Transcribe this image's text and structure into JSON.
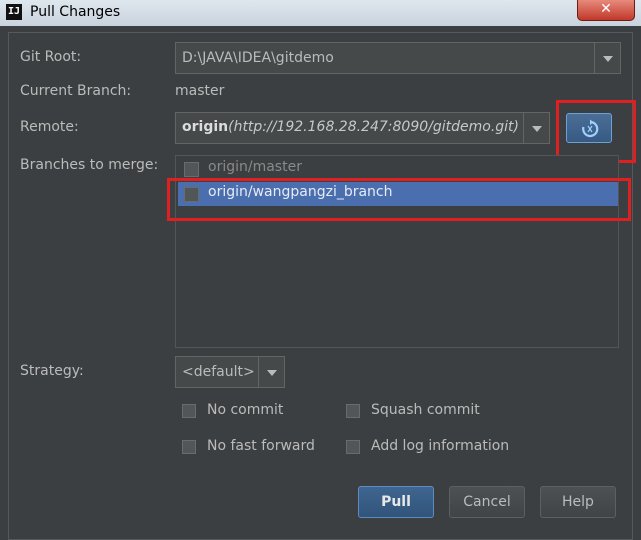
{
  "window": {
    "title": "Pull Changes",
    "app_icon_text": "IJ",
    "close_glyph": "✕"
  },
  "form": {
    "git_root": {
      "label": "Git Root:",
      "value": "D:\\JAVA\\IDEA\\gitdemo"
    },
    "current_branch": {
      "label": "Current Branch:",
      "value": "master"
    },
    "remote": {
      "label": "Remote:",
      "name": "origin",
      "url": "(http://192.168.28.247:8090/gitdemo.git)"
    },
    "branches": {
      "label": "Branches to merge:",
      "items": [
        {
          "name": "origin/master",
          "checked": false,
          "selected": false,
          "enabled": false
        },
        {
          "name": "origin/wangpangzi_branch",
          "checked": false,
          "selected": true,
          "enabled": true
        }
      ]
    },
    "strategy": {
      "label": "Strategy:",
      "value": "<default>"
    },
    "options": {
      "no_commit": "No commit",
      "squash_commit": "Squash commit",
      "no_fast_forward": "No fast forward",
      "add_log_information": "Add log information"
    }
  },
  "buttons": {
    "pull": "Pull",
    "cancel": "Cancel",
    "help": "Help"
  },
  "icons": {
    "app": "intellij-icon",
    "close": "close-icon",
    "refresh": "refresh-icon",
    "dropdown": "chevron-down-icon"
  },
  "colors": {
    "background": "#3c3f41",
    "selection": "#4b6eaf",
    "annotation": "#e02020",
    "primary_button": "#3f6691"
  }
}
